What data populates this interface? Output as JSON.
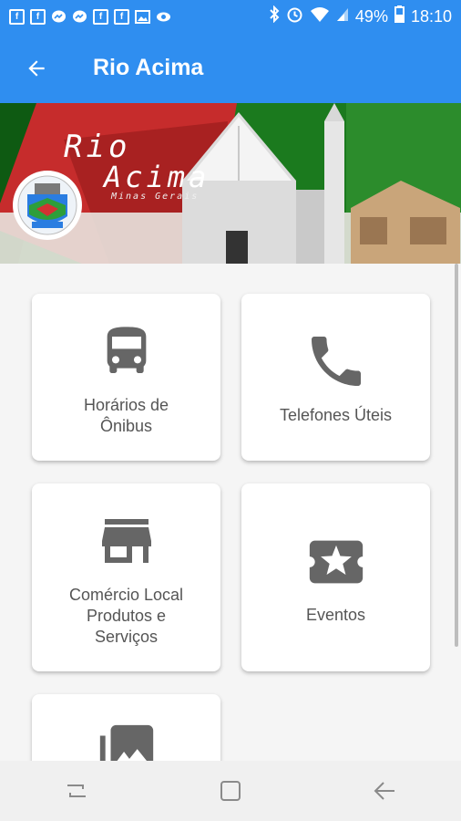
{
  "status_bar": {
    "notification_icons": [
      "facebook-icon",
      "facebook-icon",
      "messenger-icon",
      "messenger-icon",
      "facebook-icon",
      "facebook-icon",
      "image-icon",
      "eye-icon"
    ],
    "battery": "49%",
    "time": "18:10"
  },
  "app_bar": {
    "title": "Rio Acima"
  },
  "banner": {
    "line1": "Rio",
    "line2": "Acima",
    "subtitle": "Minas Gerais"
  },
  "cards": [
    {
      "label": "Horários de Ônibus",
      "icon": "bus-icon"
    },
    {
      "label": "Telefones Úteis",
      "icon": "phone-icon"
    },
    {
      "label": "Comércio Local Produtos e Serviços",
      "icon": "store-icon"
    },
    {
      "label": "Eventos",
      "icon": "ticket-star-icon"
    },
    {
      "label": "",
      "icon": "photo-library-icon"
    }
  ],
  "colors": {
    "primary": "#2f8ef0",
    "icon_gray": "#666666"
  }
}
